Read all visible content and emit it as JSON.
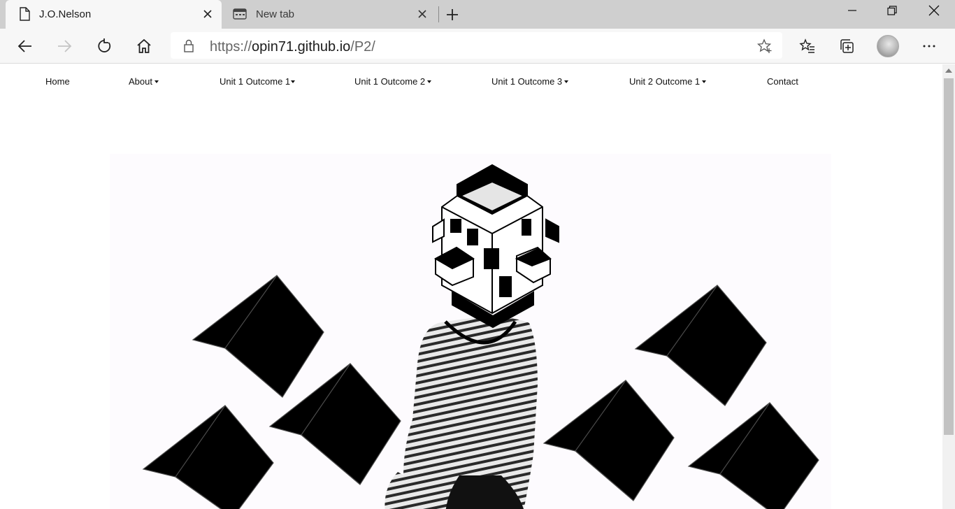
{
  "browser": {
    "tabs": [
      {
        "title": "J.O.Nelson",
        "icon": "page-icon",
        "active": true
      },
      {
        "title": "New tab",
        "icon": "new-tab-page-icon",
        "active": false
      }
    ],
    "address": {
      "scheme": "https://",
      "host": "opin71.github.io",
      "path": "/P2/"
    }
  },
  "nav": {
    "items": [
      {
        "label": "Home",
        "dropdown": false
      },
      {
        "label": "About",
        "dropdown": true
      },
      {
        "label": "Unit 1 Outcome 1",
        "dropdown": true
      },
      {
        "label": "Unit 1 Outcome 2",
        "dropdown": true
      },
      {
        "label": "Unit 1 Outcome 3",
        "dropdown": true
      },
      {
        "label": "Unit 2 Outcome 1",
        "dropdown": true
      },
      {
        "label": "Contact",
        "dropdown": false
      }
    ]
  },
  "hero": {
    "image": "figure-with-cube-head-and-floating-black-cubes"
  },
  "colors": {
    "tabstrip": "#cfcfcf",
    "toolbar": "#f7f7f7",
    "hero_bg": "#fdfbfe"
  }
}
